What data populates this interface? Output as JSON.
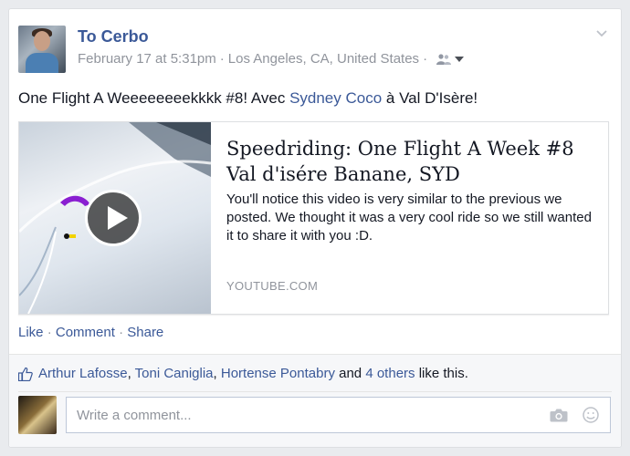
{
  "post": {
    "author": "To Cerbo",
    "date": "February 17 at 5:31pm",
    "separator": "·",
    "location": "Los Angeles, CA, United States",
    "text_before": "One Flight A Weeeeeeeekkkk #8! Avec ",
    "tagged": "Sydney Coco",
    "text_after": " à Val D'Isère!"
  },
  "attachment": {
    "title": "Speedriding: One Flight A Week #8 Val d'isére Banane, SYD",
    "description": "You'll notice this video is very similar to the previous we posted. We thought it was a very cool ride so we still wanted it to share it with you :D.",
    "source": "YOUTUBE.COM"
  },
  "actions": {
    "like": "Like",
    "comment": "Comment",
    "share": "Share",
    "dot": "·"
  },
  "likes": {
    "person1": "Arthur Lafosse",
    "comma1": ",",
    "person2": "Toni Caniglia",
    "comma2": ",",
    "person3": "Hortense Pontabry",
    "and": "and",
    "others": "4 others",
    "suffix": "like this."
  },
  "comment": {
    "placeholder": "Write a comment..."
  },
  "icons": {
    "audience": "friends-icon",
    "menu": "chevron-down-icon",
    "like_summary": "thumbs-up-icon",
    "camera": "camera-icon",
    "emoji": "emoji-icon",
    "play": "play-icon"
  },
  "colors": {
    "link": "#3b5998",
    "meta": "#90949c",
    "background": "#e9ebee"
  }
}
